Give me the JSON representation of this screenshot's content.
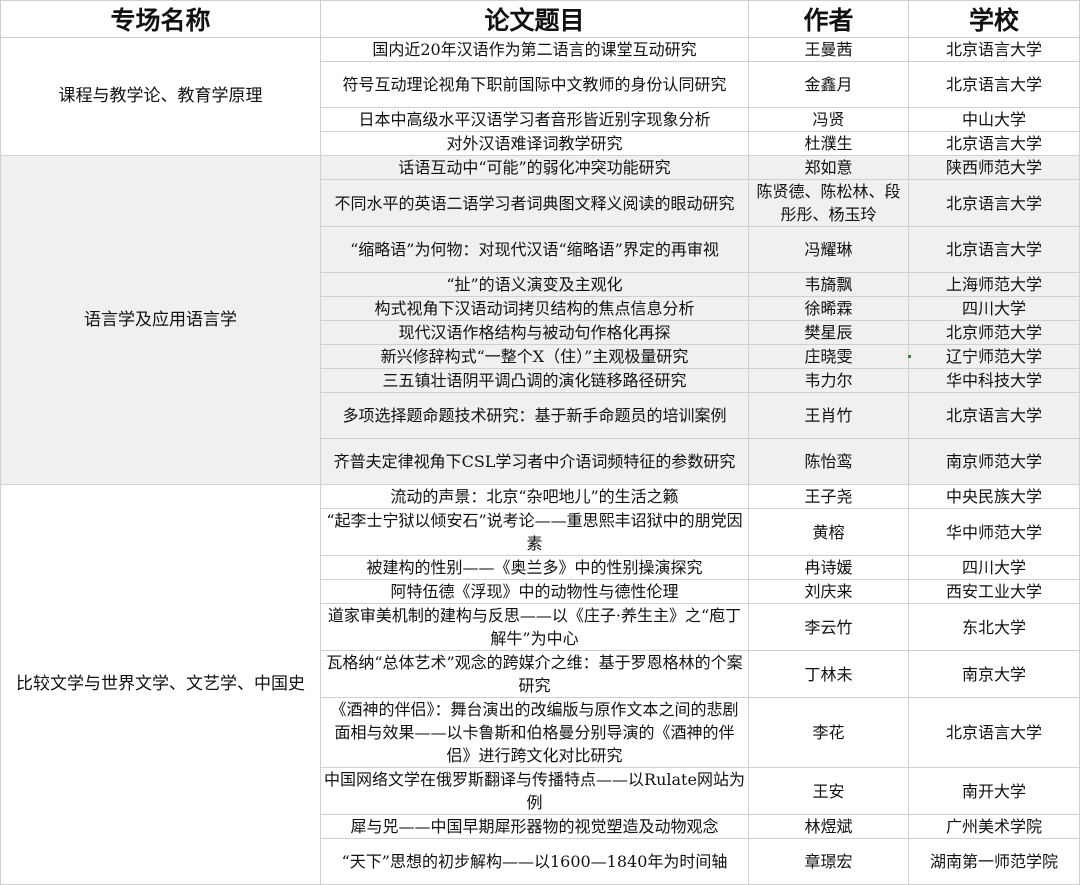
{
  "headers": [
    "专场名称",
    "论文题目",
    "作者",
    "学校"
  ],
  "sessions": [
    {
      "name": "课程与教学论、教育学原理",
      "rows": [
        {
          "title": "国内近20年汉语作为第二语言的课堂互动研究",
          "author": "王曼茜",
          "school": "北京语言大学"
        },
        {
          "title": "符号互动理论视角下职前国际中文教师的身份认同研究",
          "author": "金鑫月",
          "school": "北京语言大学"
        },
        {
          "title": "日本中高级水平汉语学习者音形皆近别字现象分析",
          "author": "冯贤",
          "school": "中山大学"
        },
        {
          "title": "对外汉语难译词教学研究",
          "author": "杜濮生",
          "school": "北京语言大学"
        }
      ]
    },
    {
      "name": "语言学及应用语言学",
      "rows": [
        {
          "title": "话语互动中“可能”的弱化冲突功能研究",
          "author": "郑如意",
          "school": "陕西师范大学"
        },
        {
          "title": "不同水平的英语二语学习者词典图文释义阅读的眼动研究",
          "author": "陈贤德、陈松林、段彤彤、杨玉玲",
          "school": "北京语言大学"
        },
        {
          "title": "“缩略语”为何物：对现代汉语“缩略语”界定的再审视",
          "author": "冯耀琳",
          "school": "北京语言大学"
        },
        {
          "title": "“扯”的语义演变及主观化",
          "author": "韦旖飘",
          "school": "上海师范大学"
        },
        {
          "title": "构式视角下汉语动词拷贝结构的焦点信息分析",
          "author": "徐晞霖",
          "school": "四川大学"
        },
        {
          "title": "现代汉语作格结构与被动句作格化再探",
          "author": "樊星辰",
          "school": "北京师范大学"
        },
        {
          "title": "新兴修辞构式“一整个X（住）”主观极量研究",
          "author": "庄晓雯",
          "school": "辽宁师范大学"
        },
        {
          "title": "三五镇壮语阴平调凸调的演化链移路径研究",
          "author": "韦力尔",
          "school": "华中科技大学"
        },
        {
          "title": "多项选择题命题技术研究：基于新手命题员的培训案例",
          "author": "王肖竹",
          "school": "北京语言大学"
        },
        {
          "title": "齐普夫定律视角下CSL学习者中介语词频特征的参数研究",
          "author": "陈怡鸾",
          "school": "南京师范大学"
        }
      ]
    },
    {
      "name": "比较文学与世界文学、文艺学、中国史",
      "rows": [
        {
          "title": "流动的声景：北京“杂吧地儿”的生活之籁",
          "author": "王子尧",
          "school": "中央民族大学"
        },
        {
          "title": "“起李士宁狱以倾安石”说考论——重思熙丰诏狱中的朋党因素",
          "author": "黄榕",
          "school": "华中师范大学"
        },
        {
          "title": "被建构的性别——《奥兰多》中的性别操演探究",
          "author": "冉诗媛",
          "school": "四川大学"
        },
        {
          "title": "阿特伍德《浮现》中的动物性与德性伦理",
          "author": "刘庆来",
          "school": "西安工业大学"
        },
        {
          "title": "道家审美机制的建构与反思——以《庄子·养生主》之“庖丁解牛”为中心",
          "author": "李云竹",
          "school": "东北大学"
        },
        {
          "title": "瓦格纳“总体艺术”观念的跨媒介之维：基于罗恩格林的个案研究",
          "author": "丁林未",
          "school": "南京大学"
        },
        {
          "title": "《酒神的伴侣》：舞台演出的改编版与原作文本之间的悲剧面相与效果——以卡鲁斯和伯格曼分别导演的《酒神的伴侣》进行跨文化对比研究",
          "author": "李花",
          "school": "北京语言大学"
        },
        {
          "title": "中国网络文学在俄罗斯翻译与传播特点——以Rulate网站为例",
          "author": "王安",
          "school": "南开大学"
        },
        {
          "title": "犀与兕——中国早期犀形器物的视觉塑造及动物观念",
          "author": "林煜斌",
          "school": "广州美术学院"
        },
        {
          "title": "“天下”思想的初步解构——以1600—1840年为时间轴",
          "author": "章璟宏",
          "school": "湖南第一师范学院"
        }
      ]
    }
  ]
}
